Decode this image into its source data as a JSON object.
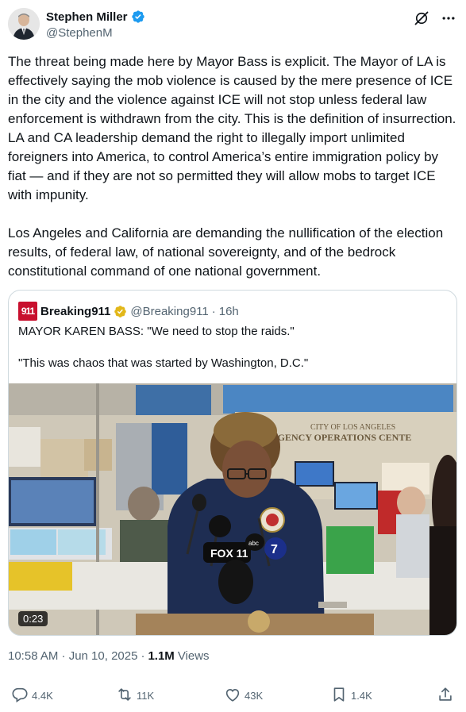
{
  "author": {
    "name": "Stephen Miller",
    "handle": "@StephenM"
  },
  "tweet": {
    "text": "The threat being made here by Mayor Bass is explicit. The Mayor of LA is effectively saying the mob violence is caused by the mere presence of ICE in the city and the violence against ICE will not stop unless federal law enforcement is withdrawn from the city. This is the definition of insurrection. LA and CA leadership demand the right to illegally import unlimited foreigners into America, to control America’s entire immigration policy by fiat — and if they are not so permitted they will allow mobs to target ICE with impunity.\n\nLos Angeles and California are demanding the nullification of the election results, of federal law, of national sovereignty, and of the bedrock constitutional command of one national government."
  },
  "quote": {
    "logo_text": "911",
    "name": "Breaking911",
    "handle": "@Breaking911",
    "separator": "·",
    "time": "16h",
    "line1": "MAYOR KAREN BASS: \"We need to stop the raids.\"",
    "line2": "\"This was chaos that was started by Washington, D.C.\"",
    "media": {
      "duration": "0:23",
      "wall_sign_line1": "CITY OF LOS ANGELES",
      "wall_sign_line2": "RGENCY OPERATIONS CENTE",
      "mic_fox": "FOX 11",
      "mic_abc": "abc",
      "mic_seven": "7"
    }
  },
  "meta": {
    "timestamp": "10:58 AM · Jun 10, 2025",
    "separator": "·",
    "views_count": "1.1M",
    "views_label": "Views"
  },
  "actions": {
    "replies": "4.4K",
    "reposts": "11K",
    "likes": "43K",
    "bookmarks": "1.4K"
  },
  "colors": {
    "verified_blue": "#1d9bf0",
    "verified_gold": "#e2b719",
    "breaking_red": "#c8102e",
    "text_primary": "#0f1419",
    "text_secondary": "#536471",
    "border": "#cfd9de"
  },
  "icons": {
    "verified": "verified-badge-icon",
    "grok": "grok-icon",
    "more": "more-icon",
    "reply": "reply-icon",
    "repost": "repost-icon",
    "like": "like-icon",
    "bookmark": "bookmark-icon",
    "share": "share-icon"
  }
}
